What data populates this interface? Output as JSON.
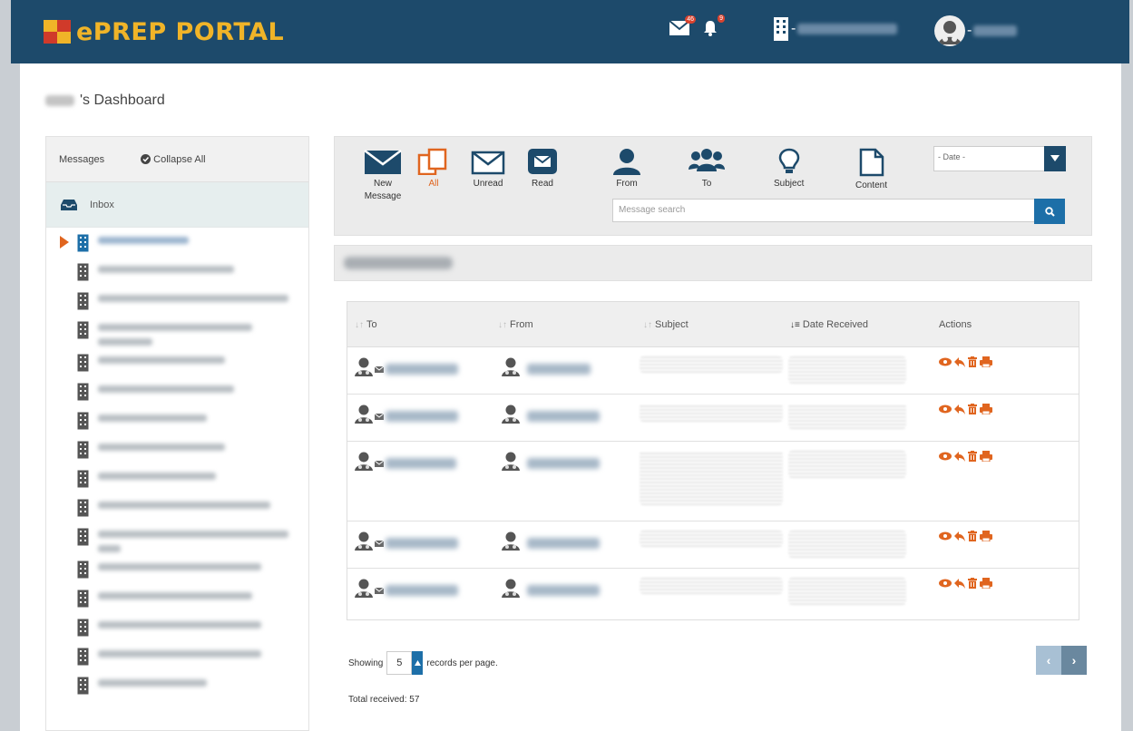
{
  "header": {
    "app_title": "ePREP PORTAL",
    "mail_badge": "46",
    "bell_badge": "9"
  },
  "dashboard": {
    "title_suffix": "'s Dashboard"
  },
  "sidebar": {
    "messages_label": "Messages",
    "collapse_label": "Collapse All",
    "inbox_label": "Inbox",
    "folder_count": 17
  },
  "toolbar": {
    "new_label": "New",
    "new_label2": "Message",
    "all_label": "All",
    "unread_label": "Unread",
    "read_label": "Read",
    "from_label": "From",
    "to_label": "To",
    "subject_label": "Subject",
    "content_label": "Content",
    "date_select": "- Date -",
    "search_placeholder": "Message search"
  },
  "table": {
    "headers": {
      "to": "To",
      "from": "From",
      "subject": "Subject",
      "date": "Date Received",
      "actions": "Actions"
    }
  },
  "footer": {
    "showing_label": "Showing",
    "per_page_value": "5",
    "records_label": "records per page.",
    "total_label": "Total received: 57"
  },
  "colors": {
    "header_bg": "#1d4a6b",
    "accent_orange": "#e0651f",
    "logo_gold": "#f0b428",
    "link_blue": "#1d6fa8"
  }
}
